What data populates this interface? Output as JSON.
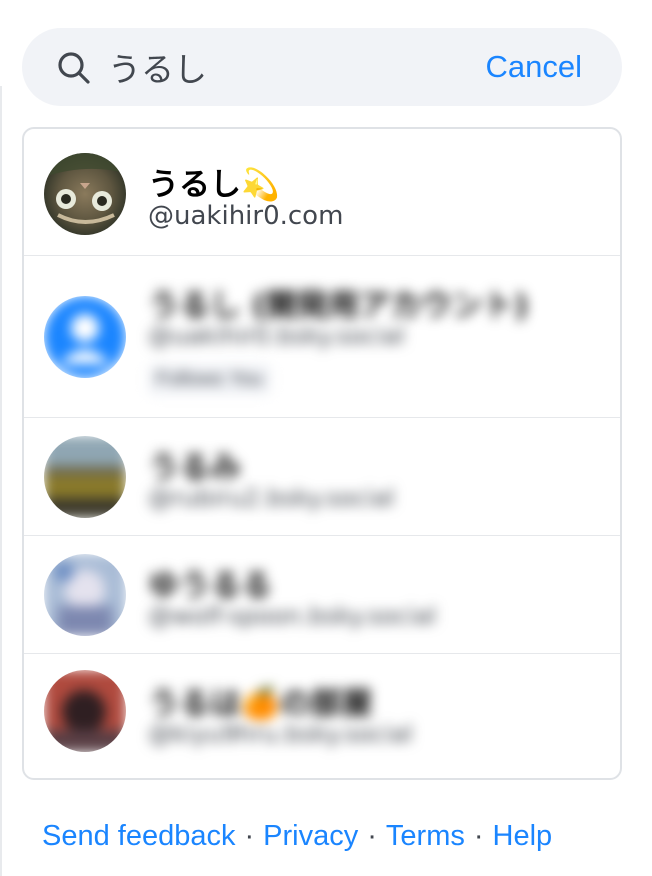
{
  "search": {
    "value": "うるし",
    "placeholder": "",
    "icon": "search-icon",
    "cancel_label": "Cancel"
  },
  "results": [
    {
      "name": "うるし💫",
      "handle": "@uakihir0.com",
      "blurred": false
    },
    {
      "name": "うるし (開発用アカウント)",
      "handle": "@uakihir0.bsky.social",
      "badge": "Follows You",
      "blurred": true
    },
    {
      "name": "うるみ",
      "handle": "@rubiru2.bsky.social",
      "blurred": true
    },
    {
      "name": "ゆうるる",
      "handle": "@wolf-spoon.bsky.social",
      "blurred": true
    },
    {
      "name": "うるは🍊の部屋",
      "handle": "@kiyu9hru.bsky.social",
      "blurred": true
    }
  ],
  "footer": {
    "links": [
      "Send feedback",
      "Privacy",
      "Terms",
      "Help"
    ],
    "separator": "·"
  },
  "colors": {
    "accent": "#1a85ff",
    "search_bg": "#f1f3f7",
    "muted_text": "#42474f",
    "default_avatar": "#1a85ff"
  }
}
